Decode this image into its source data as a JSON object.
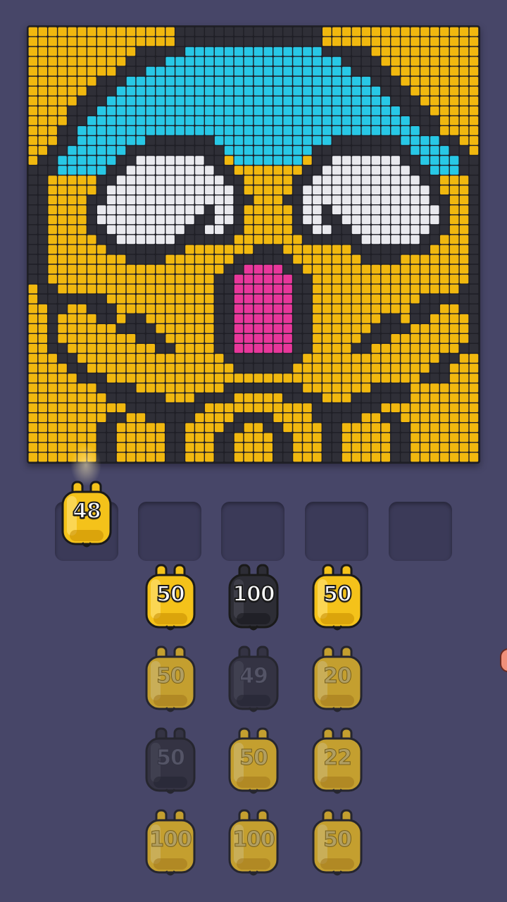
{
  "board": {
    "cols": 46,
    "rows": 44,
    "colors": {
      "Y": "#f1b80f",
      "B": "#2f2f37",
      "C": "#28c8e6",
      "W": "#e9e9ee",
      "P": "#e8379b"
    },
    "pattern": [
      "YYYYYYYYYYYYYYYBBBBBBBBBBBBBBBYYYYYYYYYYYYYYYY",
      "YYYYYYYYYYYYYYYBBBBBBBBBBBBBBBYYYYYYYYYYYYYYYY",
      "YYYYYYYYYYYBBBBBCCCCCCCCCCCCCCBBBBBYYYYYYYYYYY",
      "YYYYYYYYYYBBBBCCCCCCCCCCCCCCCCCCBBBBYYYYYYYYYY",
      "YYYYYYYYYBBBCCCCCCCCCCCCCCCCCCCCCBBBBYYYYYYYYY",
      "YYYYYYYBBBCCCCCCCCCCCCCCCCCCCCCCCCCBBBYYYYYYYY",
      "YYYYYYBBBCCCCCCCCCCCCCCCCCCCCCCCCCCCBBBYYYYYYY",
      "YYYYYBBBCCCCCCCCCCCCCCCCCCCCCCCCCCCCCBBBYYYYYY",
      "YYYYBBBCCCCCCCCCCCCCCCCCCCCCCCCCCCCCCCBBBYYYYY",
      "YYYYBBCCCCCCCCCCCCCCCCCCCCCCCCCCCCCCCCCBBBYYYY",
      "YYYBBCCCCCCCCCCCCCCCCCCCCCCCCCCCCCCCCCCCBBYYYY",
      "YYYBBCCCCCCCBBBBBBBCCCCCCCCCCCCBBBBBBBCCCCBBYYY",
      "YYBBCCCCCCBBBBBBBBBBCCCCCCCCCBBBBBBBBBBCCCCBBYY",
      "YBBCCCCCCBBWWWWWWWBBYCCCCCCCYBBWWWWWWWBBCCCCBBY",
      "BBBCCCCCBBWWWWWWWWWBBYYYYYYYBBWWWWWWWWWBBCCCBBB",
      "BBYYYYYBBWWWWWWWWWWWBBYYYYYBBWWWWWWWWWWWBBYYYBB",
      "BBYYYYYBWWWWWWWWWWWWWBYYYYYBWWWWWWWWWWWWWBYYYBB",
      "BBYYYYBBWWWWWWWWWWWWWBBYYYBBWWWWWWWWWWWWWBBYYBB",
      "BBYYYYBWWWWWWWWWWWBWWBYYYYYBWWBWWWWWWWWWWWBYYBB",
      "BBYYYYBWWWWWWWWWWBBWWBYYYYYBWWBBWWWWWWWWWWBYYBB",
      "BBYYYYBBWWWWWWWWBBWWBBYYYYYBBWWBBWWWWWWWWBBYYBB",
      "BBYYYYYBBWWWWWWBBBBBBYYYYYYYBBBBBBWWWWWWBBYYYBB",
      "BBYYYYYYBBBBBBBBYYYYYYYBBBYYYYYYYBBBBBBBBYYYYBB",
      "BBYYYYYYYYBBBBYYYYYYYBBBBBBYYYYYYYBBBBYYYYYYYBB",
      "BBYYYYYYYYYYYYYYYYYYBBPPPPBBYYYYYYYYYYYYYYYYYBB",
      "BBYYYYYYYYYYYYYYYYYBBPPPPPPBBYYYYYYYYYYYYYYYYBB",
      "YBBYYYYYYYYYYYYYYYYBBPPPPPPBBYYYYYYYYYYYYYYYBBY",
      "YBBBBBBBYYYYYYYYYYYBBPPPPPPBBYYYYYYYYYYYBBBBBBY",
      "YYBBYYBBBYYYYYYYYYYBBPPPPPPBBYYYYYYYYYYBBBYYBBY",
      "YYBYYYYBBYBBYYYYYYYBBPPPPPPBBYYYYYYYBBYBBYYYYBY",
      "YYBYYYYYYBBBBYYYYYYBBPPPPPPBBYYYYYYBBBBYYYYYYBY",
      "YYBYYYYYYYYBBBYYYYYBBPPPPPPBBYYYYYBBBYYYYYYYYBY",
      "YYBBYYYYYYYYYBBYYYYBBPPPPPPBBYYYYBBYYYYYYYYYBBY",
      "YYYBBYYYYYYYYYYYYYYYBBBBBBBBYYYYYYYYYYYYYYBBYYY",
      "YYYYBBYYYYYYYYYYYYYYYBBBBBBYYYYYYYYYYYYYYBBYYYY",
      "YYYYYBBBYYYYYYYYYYYYYYYYYYYYYYYYYYYYYYYYBBBYYYY",
      "YYYYYYYBBBBYYYYYYYYYBBBBBBBBYYYYYYYBBBBYYYYYYYY",
      "YYYYYYYYBBBBBBYYYBBBBYYYYYBBBBYYYBBBBBBYYYYYYYY",
      "YYYYYYYYYYBBBBBBBBYYYYYYYYYYYBBBBBBBYYYYYYYYYYY",
      "YYYYYYYYBBYYBBBBBYYYYBBBBYYYYBBBBBYYBBYYYYYYYYY",
      "YYYYYYYBBYYYYYBBYYYYBBYYBBYYYYBBYYYYYBBYYYYYYYY",
      "YYYYYYYBBYYYYYBBYYYBBYYYYBBYYYBBYYYYYBBYYYYYYYY",
      "YYYYYYYBBYYYYYBBYYYBBYYYYBBYYYBBYYYYYBBYYYYYYYY",
      "YYYYYYYBBYYYYYBBYYYBBYYYYBBYYYBBYYYYYBBYYYYYYYY"
    ]
  },
  "active_shooter": {
    "count": "48",
    "color": "yellow"
  },
  "slots_empty": 4,
  "queue": [
    {
      "count": "50",
      "color": "yellow",
      "faded": false
    },
    {
      "count": "100",
      "color": "black",
      "faded": false
    },
    {
      "count": "50",
      "color": "yellow",
      "faded": false
    },
    {
      "count": "50",
      "color": "yellow",
      "faded": true
    },
    {
      "count": "49",
      "color": "black",
      "faded": true
    },
    {
      "count": "20",
      "color": "yellow",
      "faded": true
    },
    {
      "count": "50",
      "color": "black",
      "faded": true
    },
    {
      "count": "50",
      "color": "yellow",
      "faded": true
    },
    {
      "count": "22",
      "color": "yellow",
      "faded": true
    },
    {
      "count": "100",
      "color": "yellow",
      "faded": true
    },
    {
      "count": "100",
      "color": "yellow",
      "faded": true
    },
    {
      "count": "50",
      "color": "yellow",
      "faded": true
    }
  ]
}
